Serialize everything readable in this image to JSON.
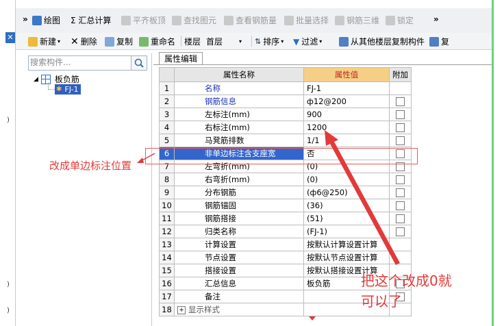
{
  "toolbar1": {
    "overflow_left": "»",
    "items": [
      {
        "label": "绘图",
        "disabled": false
      },
      {
        "label": "Σ 汇总计算",
        "disabled": false
      },
      {
        "label": "平齐板顶",
        "disabled": true
      },
      {
        "label": "查找图元",
        "disabled": true
      },
      {
        "label": "查看钢筋量",
        "disabled": true
      },
      {
        "label": "批量选择",
        "disabled": true
      },
      {
        "label": "钢筋三维",
        "disabled": true
      },
      {
        "label": "锁定",
        "disabled": true
      }
    ],
    "overflow_right": "»"
  },
  "toolbar2": {
    "new_label": "新建",
    "delete_label": "删除",
    "copy_label": "复制",
    "rename_label": "重命名",
    "floor_label": "楼层",
    "floor_value": "首层",
    "sort_label": "排序",
    "filter_label": "过滤",
    "copy_from_label": "从其他楼层复制构件",
    "trailing_label": "复"
  },
  "tree": {
    "search_placeholder": "搜索构件...",
    "root_label": "板负筋",
    "child_label": "FJ-1"
  },
  "property_panel": {
    "tab_label": "属性编辑",
    "columns": [
      "属性名称",
      "属性值",
      "附加"
    ],
    "rows": [
      {
        "idx": "1",
        "name": "名称",
        "value": "FJ-1",
        "blue": true,
        "checkbox": false
      },
      {
        "idx": "2",
        "name": "钢筋信息",
        "value": "ф12@200",
        "blue": true,
        "checkbox": true
      },
      {
        "idx": "3",
        "name": "左标注(mm)",
        "value": "900",
        "blue": false,
        "checkbox": true
      },
      {
        "idx": "4",
        "name": "右标注(mm)",
        "value": "1200",
        "blue": false,
        "checkbox": true
      },
      {
        "idx": "5",
        "name": "马凳筋排数",
        "value": "1/1",
        "blue": false,
        "checkbox": true
      },
      {
        "idx": "6",
        "name": "非单边标注含支座宽",
        "value": "否",
        "blue": false,
        "checkbox": true,
        "selected": true
      },
      {
        "idx": "7",
        "name": "左弯折(mm)",
        "value": "(0)",
        "blue": false,
        "checkbox": true
      },
      {
        "idx": "8",
        "name": "右弯折(mm)",
        "value": "(0)",
        "blue": false,
        "checkbox": true
      },
      {
        "idx": "9",
        "name": "分布钢筋",
        "value": "(ф6@250)",
        "blue": false,
        "checkbox": true
      },
      {
        "idx": "10",
        "name": "钢筋锚固",
        "value": "(36)",
        "blue": false,
        "checkbox": true
      },
      {
        "idx": "11",
        "name": "钢筋搭接",
        "value": "(51)",
        "blue": false,
        "checkbox": true
      },
      {
        "idx": "12",
        "name": "归类名称",
        "value": "(FJ-1)",
        "blue": false,
        "checkbox": true
      },
      {
        "idx": "13",
        "name": "计算设置",
        "value": "按默认计算设置计算",
        "blue": false,
        "checkbox": false
      },
      {
        "idx": "14",
        "name": "节点设置",
        "value": "按默认节点设置计算",
        "blue": false,
        "checkbox": false
      },
      {
        "idx": "15",
        "name": "搭接设置",
        "value": "按默认搭接设置计算",
        "blue": false,
        "checkbox": false
      },
      {
        "idx": "16",
        "name": "汇总信息",
        "value": "板负筋",
        "blue": false,
        "checkbox": true
      },
      {
        "idx": "17",
        "name": "备注",
        "value": "",
        "blue": false,
        "checkbox": true
      },
      {
        "idx": "18",
        "name": "显示样式",
        "value": "",
        "blue": false,
        "checkbox": false,
        "expander": "+"
      }
    ]
  },
  "annotations": {
    "left_note": "改成单边标注位置",
    "right_note_line1": "把这个改成0就",
    "right_note_line2": "可以了",
    "color": "#e23a3a"
  },
  "left_strip_marks": [
    ")",
    ")",
    ")"
  ]
}
